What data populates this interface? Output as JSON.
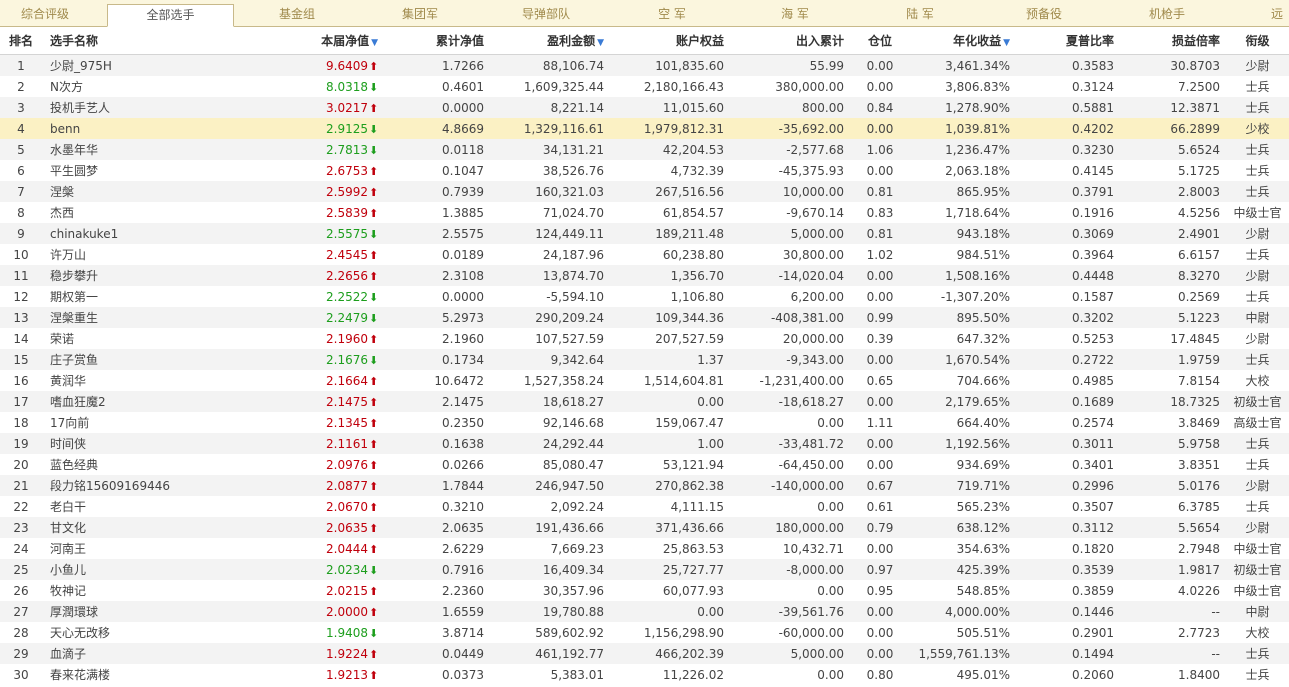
{
  "tabs": [
    "综合评级",
    "全部选手",
    "基金组",
    "集团军",
    "导弹部队",
    "空 军",
    "海 军",
    "陆 军",
    "预备役",
    "机枪手",
    "远"
  ],
  "active_tab": "全部选手",
  "colors": {
    "up": "#c0000c",
    "down": "#1d9e1d",
    "highlight_row": "#fbf1c4",
    "tab_bar": "#fbf6de"
  },
  "columns": [
    {
      "key": "rank",
      "label": "排名",
      "sort": false
    },
    {
      "key": "name",
      "label": "选手名称",
      "sort": false
    },
    {
      "key": "nav",
      "label": "本届净值",
      "sort": true
    },
    {
      "key": "cum_nav",
      "label": "累计净值",
      "sort": false
    },
    {
      "key": "profit",
      "label": "盈利金额",
      "sort": true
    },
    {
      "key": "equity",
      "label": "账户权益",
      "sort": false
    },
    {
      "key": "flow",
      "label": "出入累计",
      "sort": false
    },
    {
      "key": "position",
      "label": "仓位",
      "sort": false
    },
    {
      "key": "annual",
      "label": "年化收益",
      "sort": true
    },
    {
      "key": "sharpe",
      "label": "夏普比率",
      "sort": false
    },
    {
      "key": "pl_ratio",
      "label": "损益倍率",
      "sort": false
    },
    {
      "key": "rank_title",
      "label": "衔级",
      "sort": false
    }
  ],
  "sort_icon": "sort-down-icon",
  "highlight_rank": "4",
  "rows": [
    {
      "rank": "1",
      "name": "少尉_975H",
      "nav": "9.6409",
      "dir": "up",
      "cum_nav": "1.7266",
      "profit": "88,106.74",
      "equity": "101,835.60",
      "flow": "55.99",
      "position": "0.00",
      "annual": "3,461.34%",
      "sharpe": "0.3583",
      "pl_ratio": "30.8703",
      "rank_title": "少尉"
    },
    {
      "rank": "2",
      "name": "N次方",
      "nav": "8.0318",
      "dir": "down",
      "cum_nav": "0.4601",
      "profit": "1,609,325.44",
      "equity": "2,180,166.43",
      "flow": "380,000.00",
      "position": "0.00",
      "annual": "3,806.83%",
      "sharpe": "0.3124",
      "pl_ratio": "7.2500",
      "rank_title": "士兵"
    },
    {
      "rank": "3",
      "name": "投机手艺人",
      "nav": "3.0217",
      "dir": "up",
      "cum_nav": "0.0000",
      "profit": "8,221.14",
      "equity": "11,015.60",
      "flow": "800.00",
      "position": "0.84",
      "annual": "1,278.90%",
      "sharpe": "0.5881",
      "pl_ratio": "12.3871",
      "rank_title": "士兵"
    },
    {
      "rank": "4",
      "name": "benn",
      "nav": "2.9125",
      "dir": "down",
      "cum_nav": "4.8669",
      "profit": "1,329,116.61",
      "equity": "1,979,812.31",
      "flow": "-35,692.00",
      "position": "0.00",
      "annual": "1,039.81%",
      "sharpe": "0.4202",
      "pl_ratio": "66.2899",
      "rank_title": "少校"
    },
    {
      "rank": "5",
      "name": "水墨年华",
      "nav": "2.7813",
      "dir": "down",
      "cum_nav": "0.0118",
      "profit": "34,131.21",
      "equity": "42,204.53",
      "flow": "-2,577.68",
      "position": "1.06",
      "annual": "1,236.47%",
      "sharpe": "0.3230",
      "pl_ratio": "5.6524",
      "rank_title": "士兵"
    },
    {
      "rank": "6",
      "name": "平生圆梦",
      "nav": "2.6753",
      "dir": "up",
      "cum_nav": "0.1047",
      "profit": "38,526.76",
      "equity": "4,732.39",
      "flow": "-45,375.93",
      "position": "0.00",
      "annual": "2,063.18%",
      "sharpe": "0.4145",
      "pl_ratio": "5.1725",
      "rank_title": "士兵"
    },
    {
      "rank": "7",
      "name": "涅槃",
      "nav": "2.5992",
      "dir": "up",
      "cum_nav": "0.7939",
      "profit": "160,321.03",
      "equity": "267,516.56",
      "flow": "10,000.00",
      "position": "0.81",
      "annual": "865.95%",
      "sharpe": "0.3791",
      "pl_ratio": "2.8003",
      "rank_title": "士兵"
    },
    {
      "rank": "8",
      "name": "杰西",
      "nav": "2.5839",
      "dir": "up",
      "cum_nav": "1.3885",
      "profit": "71,024.70",
      "equity": "61,854.57",
      "flow": "-9,670.14",
      "position": "0.83",
      "annual": "1,718.64%",
      "sharpe": "0.1916",
      "pl_ratio": "4.5256",
      "rank_title": "中级士官"
    },
    {
      "rank": "9",
      "name": "chinakuke1",
      "nav": "2.5575",
      "dir": "down",
      "cum_nav": "2.5575",
      "profit": "124,449.11",
      "equity": "189,211.48",
      "flow": "5,000.00",
      "position": "0.81",
      "annual": "943.18%",
      "sharpe": "0.3069",
      "pl_ratio": "2.4901",
      "rank_title": "少尉"
    },
    {
      "rank": "10",
      "name": "许万山",
      "nav": "2.4545",
      "dir": "up",
      "cum_nav": "0.0189",
      "profit": "24,187.96",
      "equity": "60,238.80",
      "flow": "30,800.00",
      "position": "1.02",
      "annual": "984.51%",
      "sharpe": "0.3964",
      "pl_ratio": "6.6157",
      "rank_title": "士兵"
    },
    {
      "rank": "11",
      "name": "稳步攀升",
      "nav": "2.2656",
      "dir": "up",
      "cum_nav": "2.3108",
      "profit": "13,874.70",
      "equity": "1,356.70",
      "flow": "-14,020.04",
      "position": "0.00",
      "annual": "1,508.16%",
      "sharpe": "0.4448",
      "pl_ratio": "8.3270",
      "rank_title": "少尉"
    },
    {
      "rank": "12",
      "name": "期权第一",
      "nav": "2.2522",
      "dir": "down",
      "cum_nav": "0.0000",
      "profit": "-5,594.10",
      "equity": "1,106.80",
      "flow": "6,200.00",
      "position": "0.00",
      "annual": "-1,307.20%",
      "sharpe": "0.1587",
      "pl_ratio": "0.2569",
      "rank_title": "士兵"
    },
    {
      "rank": "13",
      "name": "涅槃重生",
      "nav": "2.2479",
      "dir": "down",
      "cum_nav": "5.2973",
      "profit": "290,209.24",
      "equity": "109,344.36",
      "flow": "-408,381.00",
      "position": "0.99",
      "annual": "895.50%",
      "sharpe": "0.3202",
      "pl_ratio": "5.1223",
      "rank_title": "中尉"
    },
    {
      "rank": "14",
      "name": "荣诺",
      "nav": "2.1960",
      "dir": "up",
      "cum_nav": "2.1960",
      "profit": "107,527.59",
      "equity": "207,527.59",
      "flow": "20,000.00",
      "position": "0.39",
      "annual": "647.32%",
      "sharpe": "0.5253",
      "pl_ratio": "17.4845",
      "rank_title": "少尉"
    },
    {
      "rank": "15",
      "name": "庄子赏鱼",
      "nav": "2.1676",
      "dir": "down",
      "cum_nav": "0.1734",
      "profit": "9,342.64",
      "equity": "1.37",
      "flow": "-9,343.00",
      "position": "0.00",
      "annual": "1,670.54%",
      "sharpe": "0.2722",
      "pl_ratio": "1.9759",
      "rank_title": "士兵"
    },
    {
      "rank": "16",
      "name": "黄润华",
      "nav": "2.1664",
      "dir": "up",
      "cum_nav": "10.6472",
      "profit": "1,527,358.24",
      "equity": "1,514,604.81",
      "flow": "-1,231,400.00",
      "position": "0.65",
      "annual": "704.66%",
      "sharpe": "0.4985",
      "pl_ratio": "7.8154",
      "rank_title": "大校"
    },
    {
      "rank": "17",
      "name": "嗜血狂魔2",
      "nav": "2.1475",
      "dir": "up",
      "cum_nav": "2.1475",
      "profit": "18,618.27",
      "equity": "0.00",
      "flow": "-18,618.27",
      "position": "0.00",
      "annual": "2,179.65%",
      "sharpe": "0.1689",
      "pl_ratio": "18.7325",
      "rank_title": "初级士官"
    },
    {
      "rank": "18",
      "name": "17向前",
      "nav": "2.1345",
      "dir": "up",
      "cum_nav": "0.2350",
      "profit": "92,146.68",
      "equity": "159,067.47",
      "flow": "0.00",
      "position": "1.11",
      "annual": "664.40%",
      "sharpe": "0.2574",
      "pl_ratio": "3.8469",
      "rank_title": "高级士官"
    },
    {
      "rank": "19",
      "name": "时间侠",
      "nav": "2.1161",
      "dir": "up",
      "cum_nav": "0.1638",
      "profit": "24,292.44",
      "equity": "1.00",
      "flow": "-33,481.72",
      "position": "0.00",
      "annual": "1,192.56%",
      "sharpe": "0.3011",
      "pl_ratio": "5.9758",
      "rank_title": "士兵"
    },
    {
      "rank": "20",
      "name": "蓝色经典",
      "nav": "2.0976",
      "dir": "up",
      "cum_nav": "0.0266",
      "profit": "85,080.47",
      "equity": "53,121.94",
      "flow": "-64,450.00",
      "position": "0.00",
      "annual": "934.69%",
      "sharpe": "0.3401",
      "pl_ratio": "3.8351",
      "rank_title": "士兵"
    },
    {
      "rank": "21",
      "name": "段力铭15609169446",
      "nav": "2.0877",
      "dir": "up",
      "cum_nav": "1.7844",
      "profit": "246,947.50",
      "equity": "270,862.38",
      "flow": "-140,000.00",
      "position": "0.67",
      "annual": "719.71%",
      "sharpe": "0.2996",
      "pl_ratio": "5.0176",
      "rank_title": "少尉"
    },
    {
      "rank": "22",
      "name": "老白干",
      "nav": "2.0670",
      "dir": "up",
      "cum_nav": "0.3210",
      "profit": "2,092.24",
      "equity": "4,111.15",
      "flow": "0.00",
      "position": "0.61",
      "annual": "565.23%",
      "sharpe": "0.3507",
      "pl_ratio": "6.3785",
      "rank_title": "士兵"
    },
    {
      "rank": "23",
      "name": "甘文化",
      "nav": "2.0635",
      "dir": "up",
      "cum_nav": "2.0635",
      "profit": "191,436.66",
      "equity": "371,436.66",
      "flow": "180,000.00",
      "position": "0.79",
      "annual": "638.12%",
      "sharpe": "0.3112",
      "pl_ratio": "5.5654",
      "rank_title": "少尉"
    },
    {
      "rank": "24",
      "name": "河南王",
      "nav": "2.0444",
      "dir": "up",
      "cum_nav": "2.6229",
      "profit": "7,669.23",
      "equity": "25,863.53",
      "flow": "10,432.71",
      "position": "0.00",
      "annual": "354.63%",
      "sharpe": "0.1820",
      "pl_ratio": "2.7948",
      "rank_title": "中级士官"
    },
    {
      "rank": "25",
      "name": "小鱼儿",
      "nav": "2.0234",
      "dir": "down",
      "cum_nav": "0.7916",
      "profit": "16,409.34",
      "equity": "25,727.77",
      "flow": "-8,000.00",
      "position": "0.97",
      "annual": "425.39%",
      "sharpe": "0.3539",
      "pl_ratio": "1.9817",
      "rank_title": "初级士官"
    },
    {
      "rank": "26",
      "name": "牧神记",
      "nav": "2.0215",
      "dir": "up",
      "cum_nav": "2.2360",
      "profit": "30,357.96",
      "equity": "60,077.93",
      "flow": "0.00",
      "position": "0.95",
      "annual": "548.85%",
      "sharpe": "0.3859",
      "pl_ratio": "4.0226",
      "rank_title": "中级士官"
    },
    {
      "rank": "27",
      "name": "厚潤環球",
      "nav": "2.0000",
      "dir": "up",
      "cum_nav": "1.6559",
      "profit": "19,780.88",
      "equity": "0.00",
      "flow": "-39,561.76",
      "position": "0.00",
      "annual": "4,000.00%",
      "sharpe": "0.1446",
      "pl_ratio": "--",
      "rank_title": "中尉"
    },
    {
      "rank": "28",
      "name": "天心无改移",
      "nav": "1.9408",
      "dir": "down",
      "cum_nav": "3.8714",
      "profit": "589,602.92",
      "equity": "1,156,298.90",
      "flow": "-60,000.00",
      "position": "0.00",
      "annual": "505.51%",
      "sharpe": "0.2901",
      "pl_ratio": "2.7723",
      "rank_title": "大校"
    },
    {
      "rank": "29",
      "name": "血滴子",
      "nav": "1.9224",
      "dir": "up",
      "cum_nav": "0.0449",
      "profit": "461,192.77",
      "equity": "466,202.39",
      "flow": "5,000.00",
      "position": "0.00",
      "annual": "1,559,761.13%",
      "sharpe": "0.1494",
      "pl_ratio": "--",
      "rank_title": "士兵"
    },
    {
      "rank": "30",
      "name": "春来花满楼",
      "nav": "1.9213",
      "dir": "up",
      "cum_nav": "0.0373",
      "profit": "5,383.01",
      "equity": "11,226.02",
      "flow": "0.00",
      "position": "0.80",
      "annual": "495.01%",
      "sharpe": "0.2060",
      "pl_ratio": "1.8400",
      "rank_title": "士兵"
    }
  ]
}
